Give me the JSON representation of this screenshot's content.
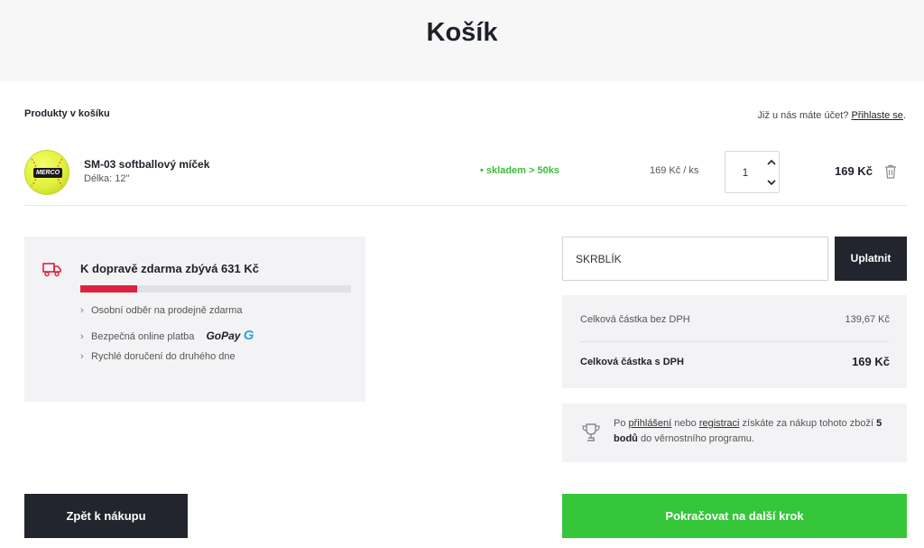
{
  "header": {
    "title": "Košík"
  },
  "cart": {
    "section_label": "Produkty v košíku",
    "account_prompt": "Již u nás máte účet?",
    "login_link": "Přihlaste se",
    "login_suffix": "."
  },
  "product": {
    "name": "SM-03 softballový míček",
    "variant": "Délka: 12\"",
    "logo_text": "MERCO",
    "stock": "• skladem > 50ks",
    "unit_price": "169 Kč / ks",
    "quantity": "1",
    "total": "169 Kč",
    "icons": {
      "up": "chevron-up-icon",
      "down": "chevron-down-icon",
      "delete": "trash-icon"
    }
  },
  "shipping": {
    "title": "K dopravě zdarma zbývá 631 Kč",
    "progress_fraction": 0.21,
    "progress_color": "#e02040",
    "benefits": [
      "Osobní odběr na prodejně zdarma",
      "Bezpečná online platba",
      "Rychlé doručení do druhého dne"
    ],
    "gopay_label": "GoPay"
  },
  "coupon": {
    "value": "SKRBLÍK",
    "button_label": "Uplatnit"
  },
  "totals": {
    "without_vat_label": "Celková částka bez DPH",
    "without_vat_value": "139,67 Kč",
    "with_vat_label": "Celková částka s DPH",
    "with_vat_value": "169 Kč"
  },
  "loyalty": {
    "prefix": "Po",
    "login_link": "přihlášení",
    "or": "nebo",
    "register_link": "registraci",
    "middle": "získáte za nákup tohoto zboží",
    "points": "5 bodů",
    "suffix": "do věrnostního programu."
  },
  "actions": {
    "back_label": "Zpět k nákupu",
    "continue_label": "Pokračovat na další krok"
  },
  "colors": {
    "accent_green": "#36c63a",
    "dark": "#22252d",
    "stock_green": "#3dbb3a",
    "progress_red": "#e02040"
  }
}
